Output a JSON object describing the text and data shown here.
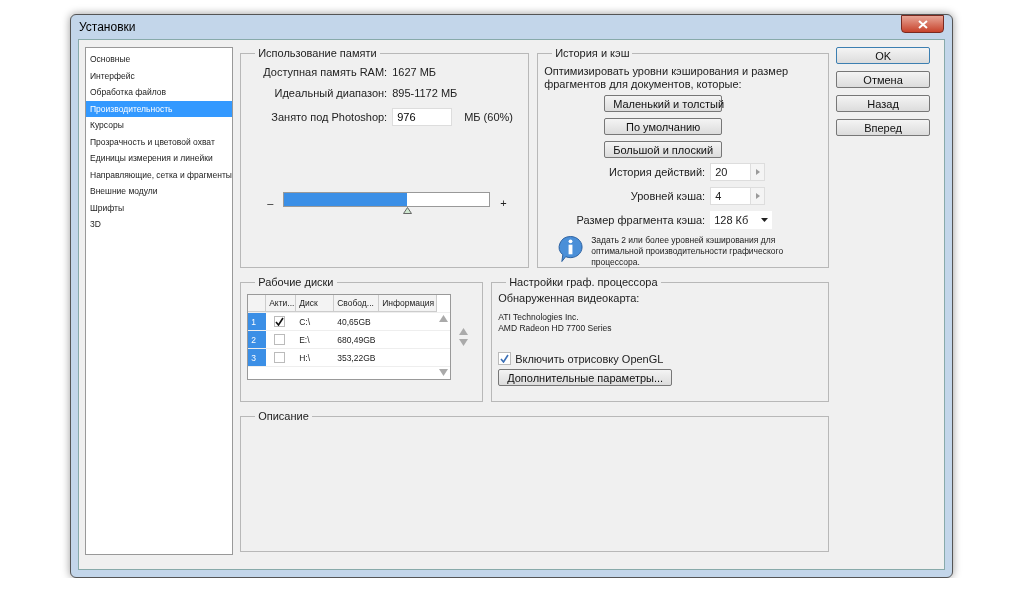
{
  "window": {
    "title": "Установки"
  },
  "sidebar": {
    "items": [
      {
        "label": "Основные",
        "selected": false
      },
      {
        "label": "Интерфейс",
        "selected": false
      },
      {
        "label": "Обработка файлов",
        "selected": false
      },
      {
        "label": "Производительность",
        "selected": true
      },
      {
        "label": "Курсоры",
        "selected": false
      },
      {
        "label": "Прозрачность и цветовой охват",
        "selected": false
      },
      {
        "label": "Единицы измерения и линейки",
        "selected": false
      },
      {
        "label": "Направляющие, сетка и фрагменты",
        "selected": false
      },
      {
        "label": "Внешние модули",
        "selected": false
      },
      {
        "label": "Шрифты",
        "selected": false
      },
      {
        "label": "3D",
        "selected": false
      }
    ]
  },
  "memory": {
    "title": "Использование памяти",
    "rows": [
      {
        "label": "Доступная память RAM:",
        "value": "1627 МБ"
      },
      {
        "label": "Идеальный диапазон:",
        "value": "895-1172 МБ"
      }
    ],
    "field": {
      "label": "Занято под Photoshop:",
      "value": "976",
      "unit": "МБ (60%)"
    },
    "slider": {
      "minus": "–",
      "plus": "+",
      "level": 0.6
    }
  },
  "history": {
    "title": "История и кэш",
    "description": "Оптимизировать уровни кэширования и размер фрагментов для документов, которые:",
    "buttons": [
      "Маленький и толстый",
      "По умолчанию",
      "Большой и плоский"
    ],
    "spinners": [
      {
        "label": "История действий:",
        "value": "20"
      },
      {
        "label": "Уровней кэша:",
        "value": "4"
      }
    ],
    "dropdown": {
      "label": "Размер фрагмента кэша:",
      "value": "128 Кб"
    },
    "note": "Задать 2 или более уровней кэширования для оптимальной производительности графического процессора."
  },
  "disks": {
    "title": "Рабочие диски",
    "columns": [
      "Акти...",
      "Диск",
      "Свобод...",
      "Информация"
    ],
    "rows": [
      {
        "number": "1",
        "checked": true,
        "disk": "C:\\",
        "free": "40,65GB"
      },
      {
        "number": "2",
        "checked": false,
        "disk": "E:\\",
        "free": "680,49GB"
      },
      {
        "number": "3",
        "checked": false,
        "disk": "H:\\",
        "free": "353,22GB"
      }
    ]
  },
  "gpu": {
    "title": "Настройки граф. процессора",
    "detected_label": "Обнаруженная видеокарта:",
    "card": [
      "ATI Technologies Inc.",
      "AMD Radeon HD 7700 Series"
    ],
    "opengl": {
      "label": "Включить отрисовку OpenGL",
      "checked": true
    },
    "button": "Дополнительные параметры..."
  },
  "description": {
    "title": "Описание"
  },
  "buttons": [
    {
      "label": "OK",
      "default": true
    },
    {
      "label": "Отмена",
      "default": false
    },
    {
      "label": "Назад",
      "default": false
    },
    {
      "label": "Вперед",
      "default": false
    }
  ]
}
